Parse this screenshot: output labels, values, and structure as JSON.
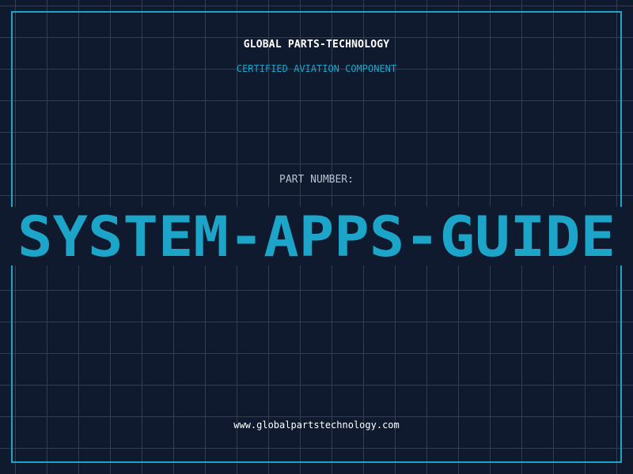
{
  "header": {
    "company": "GLOBAL PARTS-TECHNOLOGY",
    "subtitle": "CERTIFIED AVIATION COMPONENT"
  },
  "part": {
    "label": "PART NUMBER:",
    "number": "SYSTEM-APPS-GUIDE"
  },
  "footer": {
    "url": "www.globalpartstechnology.com"
  },
  "colors": {
    "background": "#101a2e",
    "grid": "#1c4760",
    "accent": "#1da5c9",
    "text": "#ffffff",
    "muted": "#b6c1cf"
  }
}
